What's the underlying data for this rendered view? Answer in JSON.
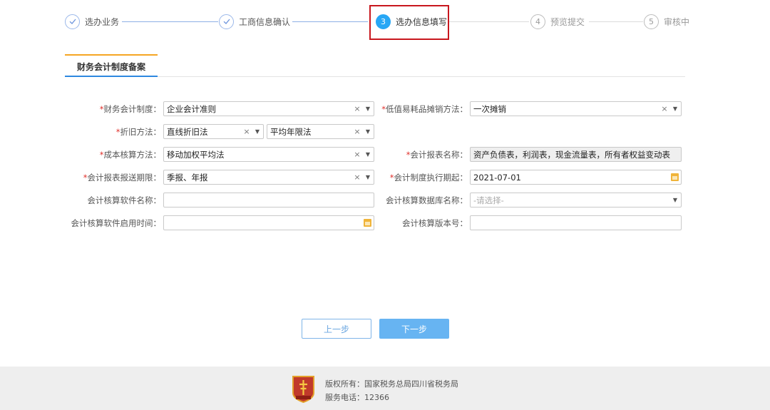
{
  "steps": [
    {
      "index": "1",
      "label": "选办业务",
      "state": "done"
    },
    {
      "index": "2",
      "label": "工商信息确认",
      "state": "done"
    },
    {
      "index": "3",
      "label": "选办信息填写",
      "state": "active"
    },
    {
      "index": "4",
      "label": "预览提交",
      "state": "todo"
    },
    {
      "index": "5",
      "label": "审核中",
      "state": "todo"
    }
  ],
  "tab": {
    "label": "财务会计制度备案"
  },
  "form": {
    "accounting_system": {
      "label": "财务会计制度：",
      "value": "企业会计准则"
    },
    "low_value_method": {
      "label": "低值易耗品摊销方法：",
      "value": "一次摊销"
    },
    "depreciation": {
      "label": "折旧方法：",
      "value1": "直线折旧法",
      "value2": "平均年限法"
    },
    "cost_method": {
      "label": "成本核算方法：",
      "value": "移动加权平均法"
    },
    "report_name": {
      "label": "会计报表名称：",
      "value": "资产负债表，利润表，现金流量表，所有者权益变动表"
    },
    "report_period": {
      "label": "会计报表报送期限：",
      "value": "季报、年报"
    },
    "start_date": {
      "label": "会计制度执行期起：",
      "value": "2021-07-01"
    },
    "software_name": {
      "label": "会计核算软件名称：",
      "value": ""
    },
    "database_name": {
      "label": "会计核算数据库名称：",
      "placeholder": "-请选择-"
    },
    "software_start": {
      "label": "会计核算软件启用时间：",
      "value": ""
    },
    "version": {
      "label": "会计核算版本号：",
      "value": ""
    }
  },
  "buttons": {
    "prev": "上一步",
    "next": "下一步"
  },
  "footer": {
    "copyright": "版权所有：国家税务总局四川省税务局",
    "phone": "服务电话：12366",
    "badge_text": "税收"
  },
  "colors": {
    "accent": "#27a7f5",
    "required": "#e0302b",
    "highlight": "#c8171e",
    "tab_top": "#f5a623"
  }
}
